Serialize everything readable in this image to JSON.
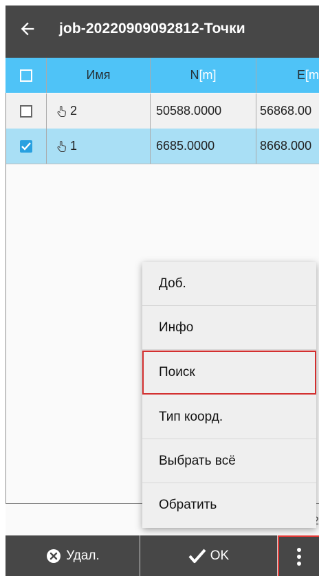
{
  "header": {
    "title": "job-20220909092812-Точки",
    "back_icon": "back-arrow-icon"
  },
  "table": {
    "columns": [
      {
        "label": "",
        "type": "checkbox"
      },
      {
        "label": "Имя"
      },
      {
        "label": "N",
        "unit": "[m]"
      },
      {
        "label": "E",
        "unit": "[m"
      }
    ],
    "rows": [
      {
        "checked": false,
        "icon": "hand-pointer-icon",
        "name": "2",
        "n": "50588.0000",
        "e": "56868.00"
      },
      {
        "checked": true,
        "icon": "hand-pointer-icon",
        "name": "1",
        "n": "6685.0000",
        "e": "8668.000"
      }
    ],
    "selected_row_color": "#a9dff5",
    "header_color": "#4fc3f7"
  },
  "page_indicator": "2/2",
  "menu": {
    "items": [
      {
        "label": "Доб."
      },
      {
        "label": "Инфо"
      },
      {
        "label": "Поиск",
        "highlighted": true
      },
      {
        "label": "Тип коорд."
      },
      {
        "label": "Выбрать всё"
      },
      {
        "label": "Обратить"
      }
    ]
  },
  "bottom_bar": {
    "delete_label": "Удал.",
    "delete_icon": "close-circle-icon",
    "ok_label": "OK",
    "ok_icon": "checkmark-icon",
    "more_icon": "more-vertical-icon"
  },
  "colors": {
    "appbar": "#474747",
    "highlight_border": "#d32f2f"
  }
}
